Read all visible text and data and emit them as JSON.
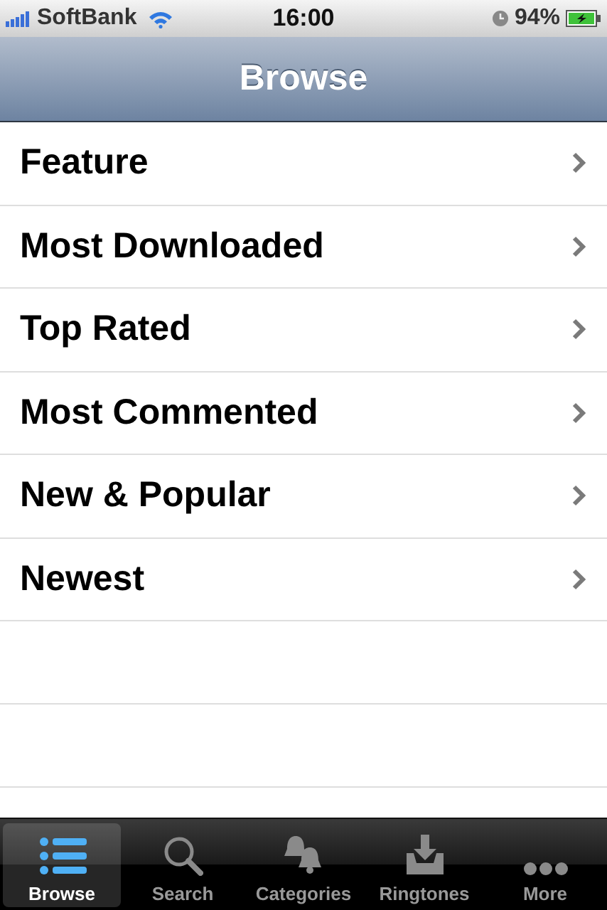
{
  "status_bar": {
    "carrier": "SoftBank",
    "time": "16:00",
    "battery": "94%"
  },
  "nav_bar": {
    "title": "Browse"
  },
  "menu": [
    {
      "label": "Feature"
    },
    {
      "label": "Most Downloaded"
    },
    {
      "label": "Top Rated"
    },
    {
      "label": "Most Commented"
    },
    {
      "label": "New & Popular"
    },
    {
      "label": "Newest"
    }
  ],
  "tab_bar": [
    {
      "label": "Browse",
      "selected": true
    },
    {
      "label": "Search",
      "selected": false
    },
    {
      "label": "Categories",
      "selected": false
    },
    {
      "label": "Ringtones",
      "selected": false
    },
    {
      "label": "More",
      "selected": false
    }
  ]
}
